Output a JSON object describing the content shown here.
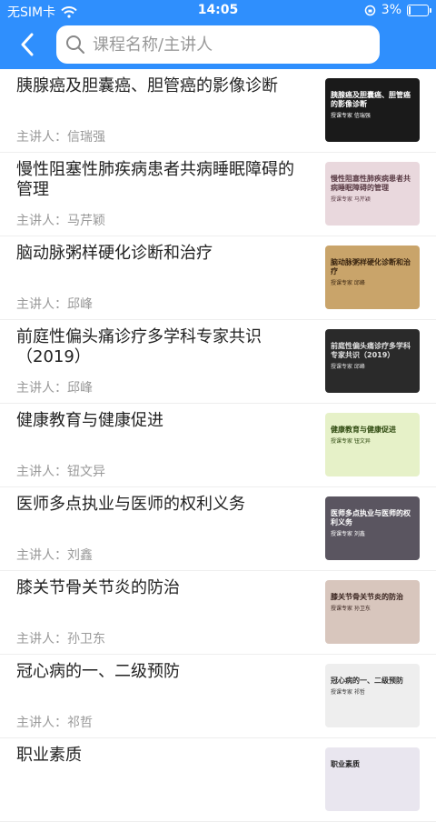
{
  "status": {
    "carrier": "无SIM卡",
    "time": "14:05",
    "battery": "3%"
  },
  "search": {
    "placeholder": "课程名称/主讲人"
  },
  "lecturer_prefix": "主讲人：",
  "courses": [
    {
      "title": "胰腺癌及胆囊癌、胆管癌的影像诊断",
      "lecturer": "信瑞强",
      "thumb_text": "胰腺癌及胆囊癌、胆管癌的影像诊断",
      "thumb_speaker": "授课专家 信瑞强",
      "thumb_bg": "#1a1a1a",
      "thumb_color": "#ffffff"
    },
    {
      "title": "慢性阻塞性肺疾病患者共病睡眠障碍的管理",
      "lecturer": "马芹颖",
      "thumb_text": "慢性阻塞性肺疾病患者共病睡眠障碍的管理",
      "thumb_speaker": "授课专家 马芹颖",
      "thumb_bg": "#e9d8dd",
      "thumb_color": "#5a3b45"
    },
    {
      "title": "脑动脉粥样硬化诊断和治疗",
      "lecturer": "邱峰",
      "thumb_text": "脑动脉粥样硬化诊断和治疗",
      "thumb_speaker": "授课专家 邱峰",
      "thumb_bg": "#c9a46a",
      "thumb_color": "#3a2510"
    },
    {
      "title": "前庭性偏头痛诊疗多学科专家共识（2019）",
      "lecturer": "邱峰",
      "thumb_text": "前庭性偏头痛诊疗多学科专家共识（2019）",
      "thumb_speaker": "授课专家 邱峰",
      "thumb_bg": "#2a2a2a",
      "thumb_color": "#e0e0e0"
    },
    {
      "title": "健康教育与健康促进",
      "lecturer": "钮文异",
      "thumb_text": "健康教育与健康促进",
      "thumb_speaker": "授课专家 钮文异",
      "thumb_bg": "#e6f1c8",
      "thumb_color": "#2f4a10"
    },
    {
      "title": "医师多点执业与医师的权利义务",
      "lecturer": "刘鑫",
      "thumb_text": "医师多点执业与医师的权利义务",
      "thumb_speaker": "授课专家 刘鑫",
      "thumb_bg": "#5a5560",
      "thumb_color": "#ffffff"
    },
    {
      "title": "膝关节骨关节炎的防治",
      "lecturer": "孙卫东",
      "thumb_text": "膝关节骨关节炎的防治",
      "thumb_speaker": "授课专家 孙卫东",
      "thumb_bg": "#d8c6bd",
      "thumb_color": "#3a2520"
    },
    {
      "title": "冠心病的一、二级预防",
      "lecturer": "祁哲",
      "thumb_text": "冠心病的一、二级预防",
      "thumb_speaker": "授课专家 祁哲",
      "thumb_bg": "#eeeeee",
      "thumb_color": "#333333"
    },
    {
      "title": "职业素质",
      "lecturer": "",
      "thumb_text": "职业素质",
      "thumb_speaker": "",
      "thumb_bg": "#e9e6ef",
      "thumb_color": "#222222"
    }
  ]
}
